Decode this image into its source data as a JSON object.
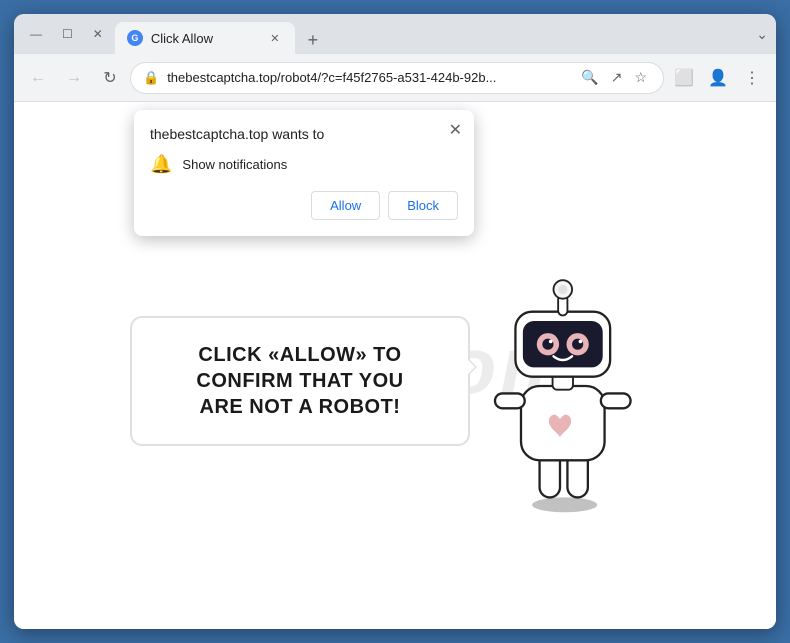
{
  "browser": {
    "title_bar": {
      "tab_label": "Click Allow",
      "new_tab_icon": "+",
      "controls": {
        "minimize": "—",
        "maximize": "☐",
        "close": "✕"
      },
      "chevron_down": "⌄"
    },
    "nav_bar": {
      "back_icon": "←",
      "forward_icon": "→",
      "refresh_icon": "↻",
      "address": "thebestcaptcha.top/robot4/?c=f45f2765-a531-424b-92b...",
      "search_icon": "🔍",
      "share_icon": "↗",
      "bookmark_icon": "☆",
      "split_icon": "⬜",
      "profile_icon": "👤",
      "menu_icon": "⋮",
      "lock_icon": "🔒"
    },
    "permission_popup": {
      "title": "thebestcaptcha.top wants to",
      "close_icon": "✕",
      "permission_item": "Show notifications",
      "bell_icon": "🔔",
      "allow_button": "Allow",
      "block_button": "Block"
    },
    "main_content": {
      "captcha_message_line1": "CLICK «ALLOW» TO CONFIRM THAT YOU",
      "captcha_message_line2": "ARE NOT A ROBOT!",
      "watermark": "risk.com"
    }
  }
}
